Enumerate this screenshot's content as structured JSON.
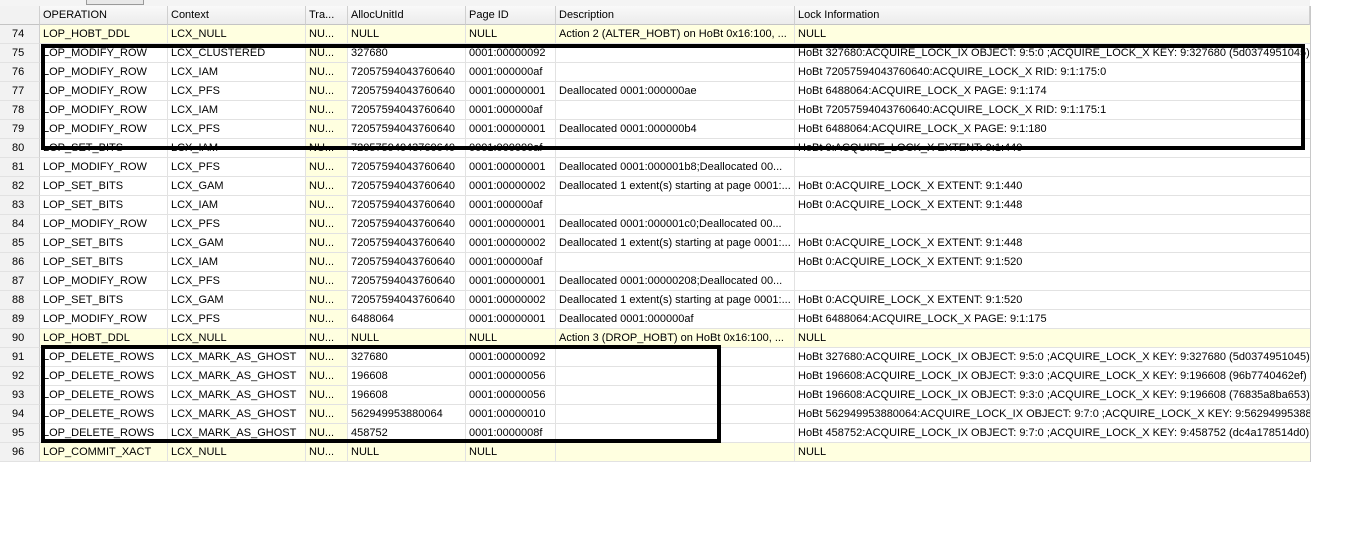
{
  "columns": {
    "num": "",
    "operation": "OPERATION",
    "context": "Context",
    "tra": "Tra...",
    "allocunitid": "AllocUnitId",
    "pageid": "Page ID",
    "description": "Description",
    "lockinfo": "Lock Information"
  },
  "rows": [
    {
      "num": "74",
      "op": "LOP_HOBT_DDL",
      "ctx": "LCX_NULL",
      "tra": "NU...",
      "alloc": "NULL",
      "page": "NULL",
      "desc": "Action 2 (ALTER_HOBT) on HoBt 0x16:100, ...",
      "lock": "NULL"
    },
    {
      "num": "75",
      "op": "LOP_MODIFY_ROW",
      "ctx": "LCX_CLUSTERED",
      "tra": "NU...",
      "alloc": "327680",
      "page": "0001:00000092",
      "desc": "",
      "lock": "HoBt 327680:ACQUIRE_LOCK_IX OBJECT: 9:5:0 ;ACQUIRE_LOCK_X KEY: 9:327680 (5d0374951045)"
    },
    {
      "num": "76",
      "op": "LOP_MODIFY_ROW",
      "ctx": "LCX_IAM",
      "tra": "NU...",
      "alloc": "72057594043760640",
      "page": "0001:000000af",
      "desc": "",
      "lock": "HoBt 72057594043760640:ACQUIRE_LOCK_X RID: 9:1:175:0"
    },
    {
      "num": "77",
      "op": "LOP_MODIFY_ROW",
      "ctx": "LCX_PFS",
      "tra": "NU...",
      "alloc": "72057594043760640",
      "page": "0001:00000001",
      "desc": "Deallocated 0001:000000ae",
      "lock": "HoBt 6488064:ACQUIRE_LOCK_X PAGE: 9:1:174"
    },
    {
      "num": "78",
      "op": "LOP_MODIFY_ROW",
      "ctx": "LCX_IAM",
      "tra": "NU...",
      "alloc": "72057594043760640",
      "page": "0001:000000af",
      "desc": "",
      "lock": "HoBt 72057594043760640:ACQUIRE_LOCK_X RID: 9:1:175:1"
    },
    {
      "num": "79",
      "op": "LOP_MODIFY_ROW",
      "ctx": "LCX_PFS",
      "tra": "NU...",
      "alloc": "72057594043760640",
      "page": "0001:00000001",
      "desc": "Deallocated 0001:000000b4",
      "lock": "HoBt 6488064:ACQUIRE_LOCK_X PAGE: 9:1:180"
    },
    {
      "num": "80",
      "op": "LOP_SET_BITS",
      "ctx": "LCX_IAM",
      "tra": "NU...",
      "alloc": "72057594043760640",
      "page": "0001:000000af",
      "desc": "",
      "lock": "HoBt 0:ACQUIRE_LOCK_X EXTENT: 9:1:440"
    },
    {
      "num": "81",
      "op": "LOP_MODIFY_ROW",
      "ctx": "LCX_PFS",
      "tra": "NU...",
      "alloc": "72057594043760640",
      "page": "0001:00000001",
      "desc": "Deallocated 0001:000001b8;Deallocated 00...",
      "lock": ""
    },
    {
      "num": "82",
      "op": "LOP_SET_BITS",
      "ctx": "LCX_GAM",
      "tra": "NU...",
      "alloc": "72057594043760640",
      "page": "0001:00000002",
      "desc": "Deallocated 1 extent(s) starting at page 0001:...",
      "lock": "HoBt 0:ACQUIRE_LOCK_X EXTENT: 9:1:440"
    },
    {
      "num": "83",
      "op": "LOP_SET_BITS",
      "ctx": "LCX_IAM",
      "tra": "NU...",
      "alloc": "72057594043760640",
      "page": "0001:000000af",
      "desc": "",
      "lock": "HoBt 0:ACQUIRE_LOCK_X EXTENT: 9:1:448"
    },
    {
      "num": "84",
      "op": "LOP_MODIFY_ROW",
      "ctx": "LCX_PFS",
      "tra": "NU...",
      "alloc": "72057594043760640",
      "page": "0001:00000001",
      "desc": "Deallocated 0001:000001c0;Deallocated 00...",
      "lock": ""
    },
    {
      "num": "85",
      "op": "LOP_SET_BITS",
      "ctx": "LCX_GAM",
      "tra": "NU...",
      "alloc": "72057594043760640",
      "page": "0001:00000002",
      "desc": "Deallocated 1 extent(s) starting at page 0001:...",
      "lock": "HoBt 0:ACQUIRE_LOCK_X EXTENT: 9:1:448"
    },
    {
      "num": "86",
      "op": "LOP_SET_BITS",
      "ctx": "LCX_IAM",
      "tra": "NU...",
      "alloc": "72057594043760640",
      "page": "0001:000000af",
      "desc": "",
      "lock": "HoBt 0:ACQUIRE_LOCK_X EXTENT: 9:1:520"
    },
    {
      "num": "87",
      "op": "LOP_MODIFY_ROW",
      "ctx": "LCX_PFS",
      "tra": "NU...",
      "alloc": "72057594043760640",
      "page": "0001:00000001",
      "desc": "Deallocated 0001:00000208;Deallocated 00...",
      "lock": ""
    },
    {
      "num": "88",
      "op": "LOP_SET_BITS",
      "ctx": "LCX_GAM",
      "tra": "NU...",
      "alloc": "72057594043760640",
      "page": "0001:00000002",
      "desc": "Deallocated 1 extent(s) starting at page 0001:...",
      "lock": "HoBt 0:ACQUIRE_LOCK_X EXTENT: 9:1:520"
    },
    {
      "num": "89",
      "op": "LOP_MODIFY_ROW",
      "ctx": "LCX_PFS",
      "tra": "NU...",
      "alloc": "6488064",
      "page": "0001:00000001",
      "desc": "Deallocated 0001:000000af",
      "lock": "HoBt 6488064:ACQUIRE_LOCK_X PAGE: 9:1:175"
    },
    {
      "num": "90",
      "op": "LOP_HOBT_DDL",
      "ctx": "LCX_NULL",
      "tra": "NU...",
      "alloc": "NULL",
      "page": "NULL",
      "desc": "Action 3 (DROP_HOBT) on HoBt 0x16:100, ...",
      "lock": "NULL"
    },
    {
      "num": "91",
      "op": "LOP_DELETE_ROWS",
      "ctx": "LCX_MARK_AS_GHOST",
      "tra": "NU...",
      "alloc": "327680",
      "page": "0001:00000092",
      "desc": "",
      "lock": "HoBt 327680:ACQUIRE_LOCK_IX OBJECT: 9:5:0 ;ACQUIRE_LOCK_X KEY: 9:327680 (5d0374951045)"
    },
    {
      "num": "92",
      "op": "LOP_DELETE_ROWS",
      "ctx": "LCX_MARK_AS_GHOST",
      "tra": "NU...",
      "alloc": "196608",
      "page": "0001:00000056",
      "desc": "",
      "lock": "HoBt 196608:ACQUIRE_LOCK_IX OBJECT: 9:3:0 ;ACQUIRE_LOCK_X KEY: 9:196608 (96b7740462ef)"
    },
    {
      "num": "93",
      "op": "LOP_DELETE_ROWS",
      "ctx": "LCX_MARK_AS_GHOST",
      "tra": "NU...",
      "alloc": "196608",
      "page": "0001:00000056",
      "desc": "",
      "lock": "HoBt 196608:ACQUIRE_LOCK_IX OBJECT: 9:3:0 ;ACQUIRE_LOCK_X KEY: 9:196608 (76835a8ba653)"
    },
    {
      "num": "94",
      "op": "LOP_DELETE_ROWS",
      "ctx": "LCX_MARK_AS_GHOST",
      "tra": "NU...",
      "alloc": "562949953880064",
      "page": "0001:00000010",
      "desc": "",
      "lock": "HoBt 562949953880064:ACQUIRE_LOCK_IX OBJECT: 9:7:0 ;ACQUIRE_LOCK_X KEY: 9:562949953880"
    },
    {
      "num": "95",
      "op": "LOP_DELETE_ROWS",
      "ctx": "LCX_MARK_AS_GHOST",
      "tra": "NU...",
      "alloc": "458752",
      "page": "0001:0000008f",
      "desc": "",
      "lock": "HoBt 458752:ACQUIRE_LOCK_IX OBJECT: 9:7:0 ;ACQUIRE_LOCK_X KEY: 9:458752 (dc4a178514d0)"
    },
    {
      "num": "96",
      "op": "LOP_COMMIT_XACT",
      "ctx": "LCX_NULL",
      "tra": "NU...",
      "alloc": "NULL",
      "page": "NULL",
      "desc": "",
      "lock": "NULL"
    }
  ],
  "null_highlight_color": "#ffffe0",
  "highlight_box_color": "#000000"
}
